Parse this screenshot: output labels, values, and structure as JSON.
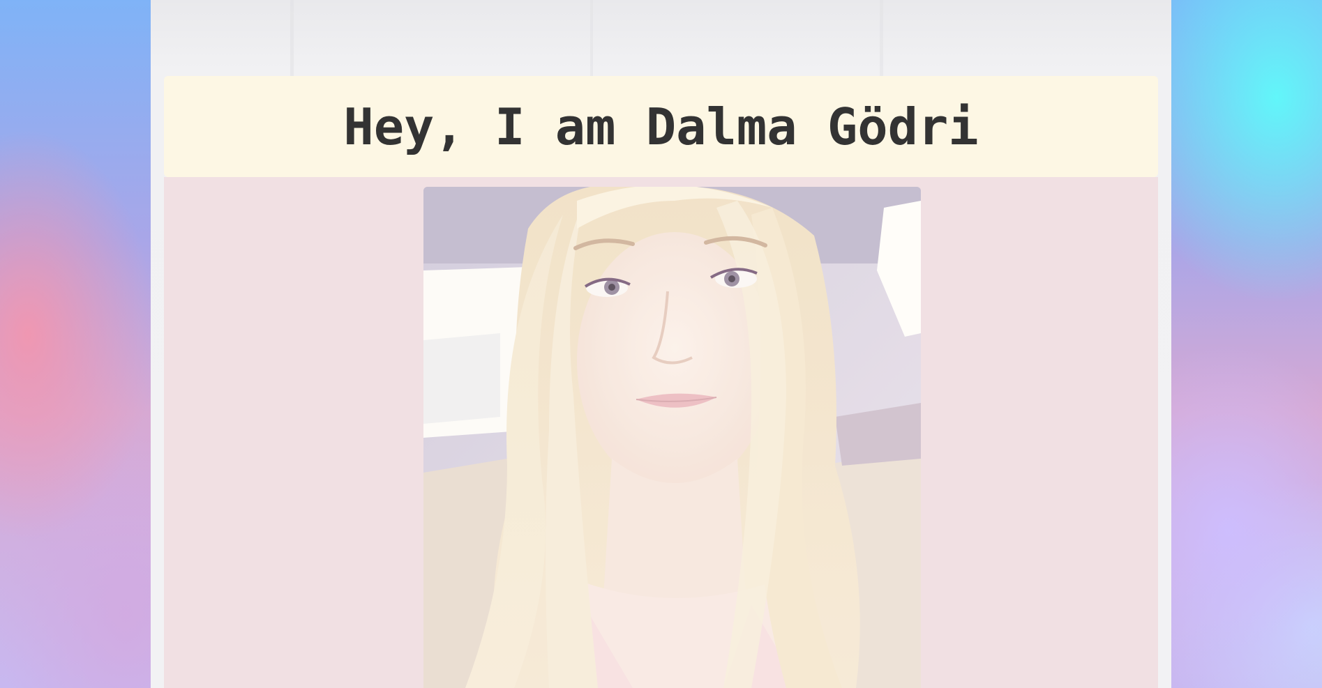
{
  "header": {
    "title": "Hey, I am Dalma Gödri"
  },
  "profile": {
    "photo_icon": "portrait-photo",
    "alt": "Dalma Gödri"
  },
  "colors": {
    "header_bg": "#fdf7e4",
    "content_bg": "#f1e0e3",
    "title_text": "#333333",
    "page_bg": "#f2f2f4"
  }
}
